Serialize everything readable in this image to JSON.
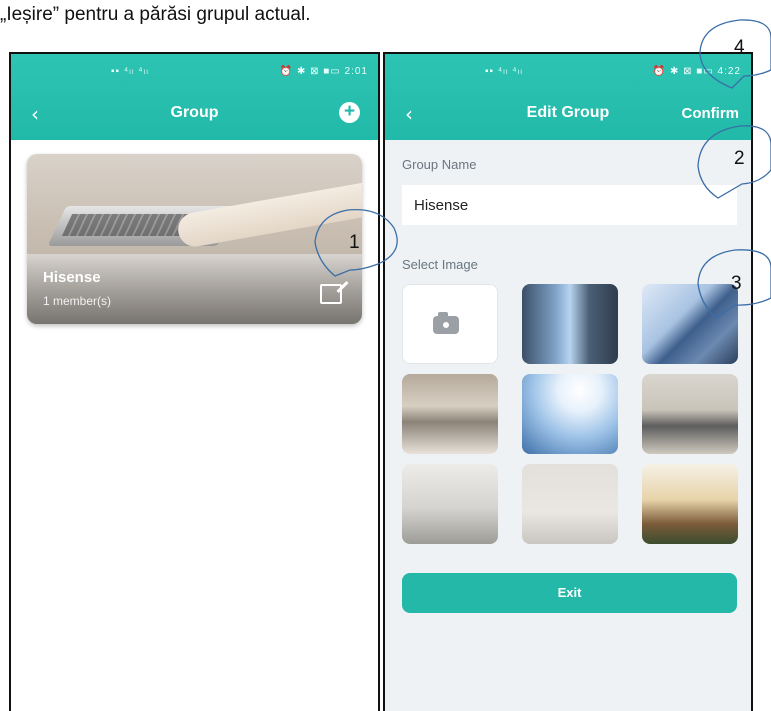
{
  "caption": "„Ieșire” pentru a părăsi grupul actual.",
  "left_screen": {
    "status_bar": {
      "left": "▪▪ ⁴ₗₗ ⁴ₗₗ",
      "right": "⏰ ✱ ⊠ ■▭ 2:01"
    },
    "nav": {
      "back_icon": "chevron-left-icon",
      "title": "Group",
      "add_icon": "plus-circle-icon"
    },
    "group_card": {
      "name": "Hisense",
      "members": "1 member(s)",
      "edit_icon": "edit-icon"
    }
  },
  "right_screen": {
    "status_bar": {
      "left": "▪▪ ⁴ₗₗ ⁴ₗₗ",
      "right": "⏰ ✱ ⊠ ■▭ 4:22"
    },
    "nav": {
      "back_icon": "chevron-left-icon",
      "title": "Edit Group",
      "confirm": "Confirm"
    },
    "group_name_label": "Group Name",
    "group_name_value": "Hisense",
    "select_image_label": "Select Image",
    "images": [
      "camera",
      "skyscraper-glass",
      "office-building",
      "laptop-desk",
      "glass-tower-sky",
      "living-room",
      "bicycle-decor",
      "wall-clock",
      "bookshelf-plant"
    ],
    "exit_label": "Exit"
  },
  "callouts": [
    "1",
    "2",
    "3",
    "4"
  ],
  "colors": {
    "accent": "#21b9a8",
    "background": "#eef2f5"
  }
}
